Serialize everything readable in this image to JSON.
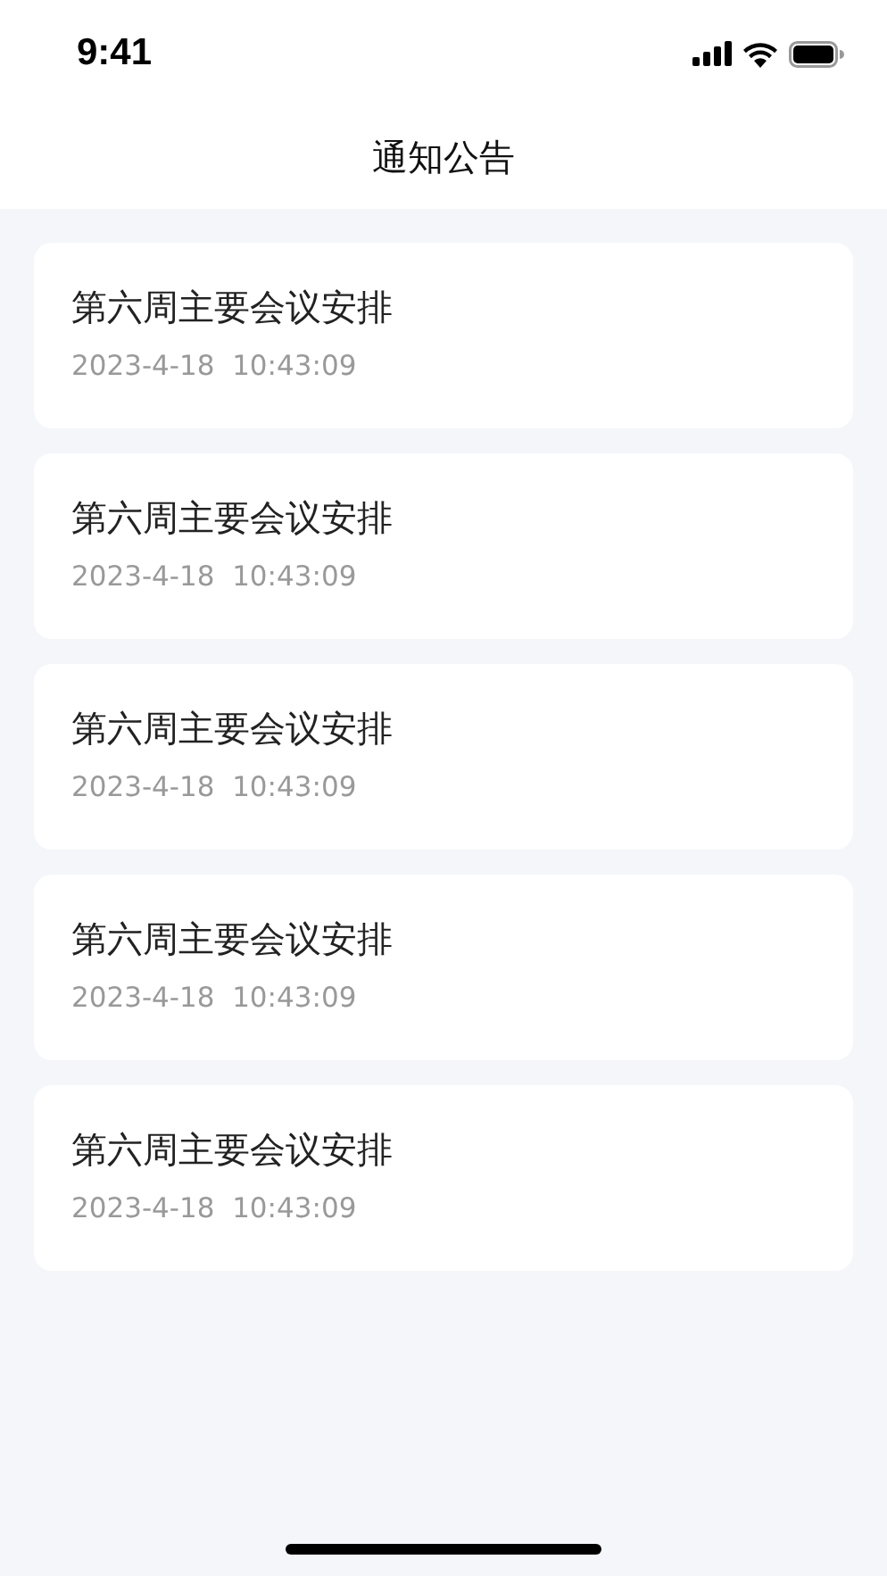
{
  "status_bar": {
    "time": "9:41"
  },
  "header": {
    "title": "通知公告"
  },
  "notices": [
    {
      "title": "第六周主要会议安排",
      "date": "2023-4-18",
      "time": "10:43:09"
    },
    {
      "title": "第六周主要会议安排",
      "date": "2023-4-18",
      "time": "10:43:09"
    },
    {
      "title": "第六周主要会议安排",
      "date": "2023-4-18",
      "time": "10:43:09"
    },
    {
      "title": "第六周主要会议安排",
      "date": "2023-4-18",
      "time": "10:43:09"
    },
    {
      "title": "第六周主要会议安排",
      "date": "2023-4-18",
      "time": "10:43:09"
    }
  ]
}
